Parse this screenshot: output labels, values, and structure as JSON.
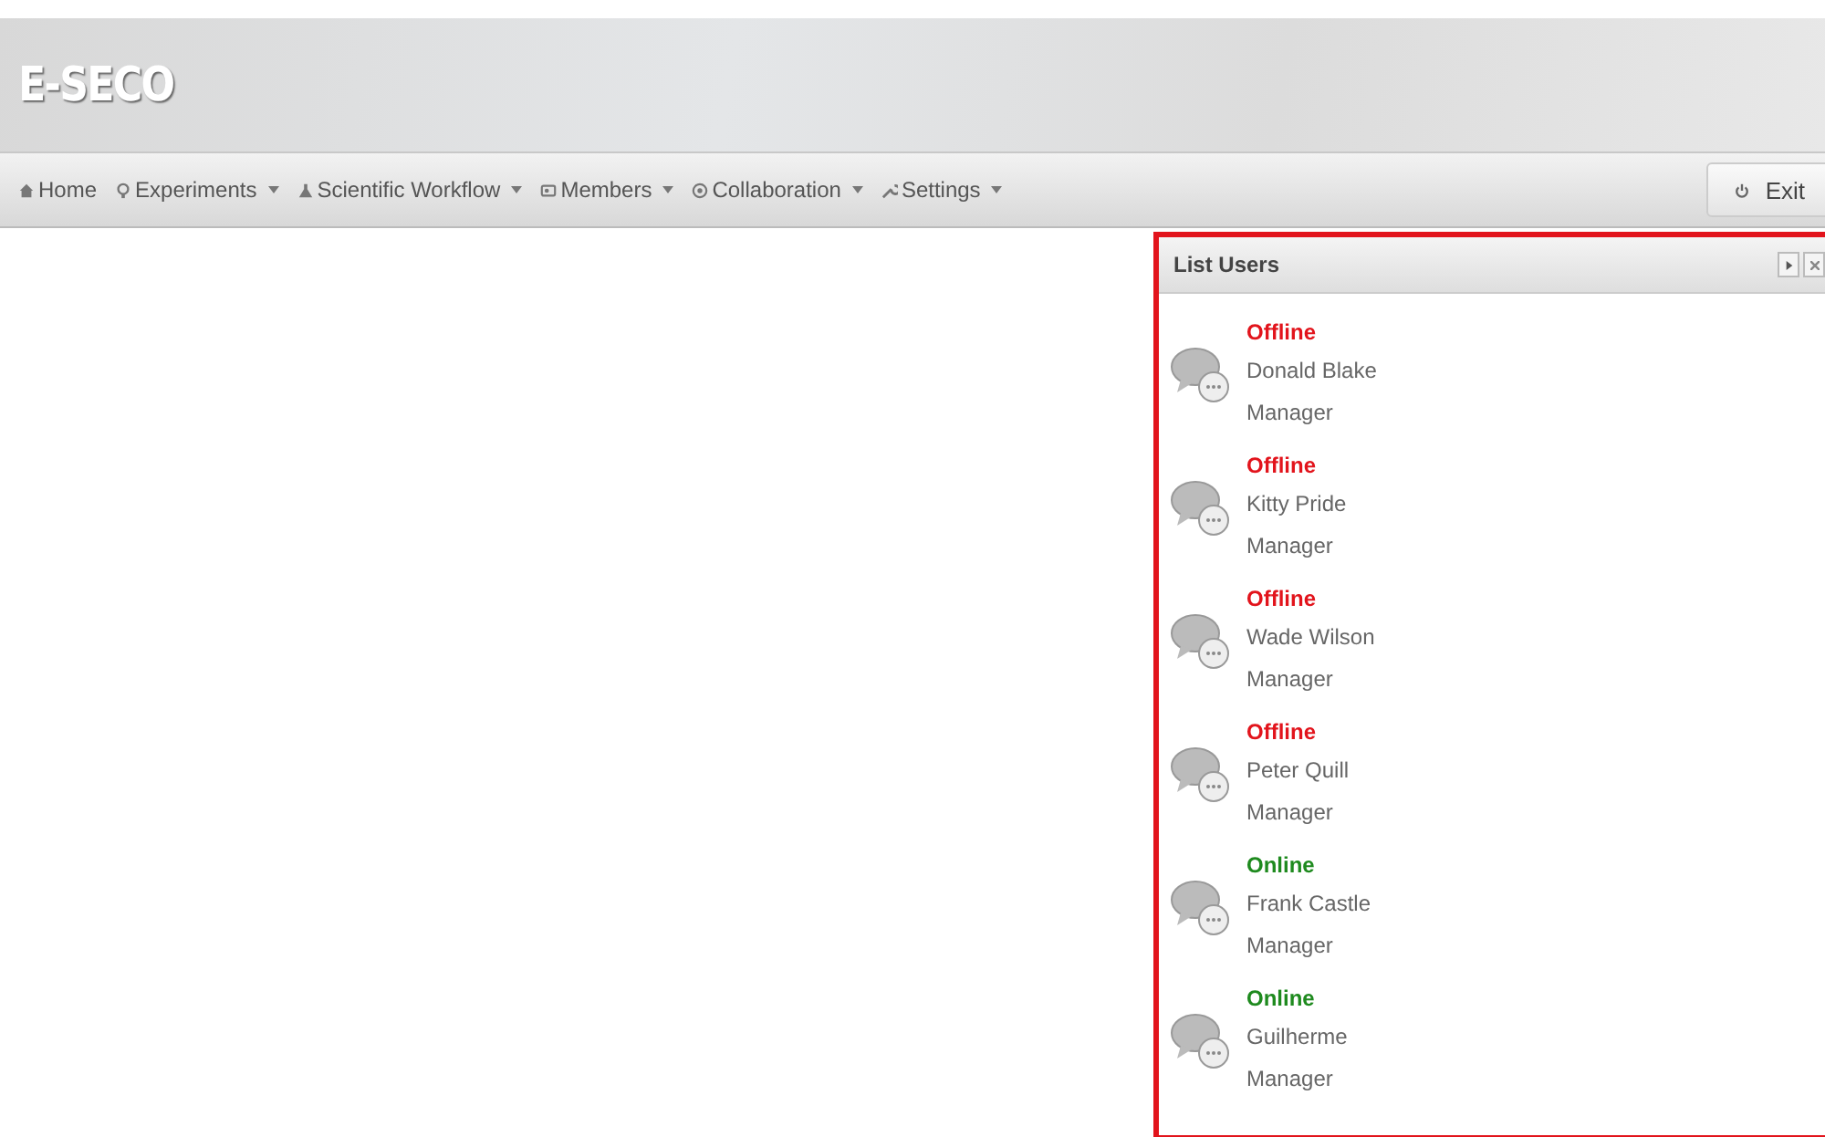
{
  "header": {
    "logo": "E-SECO"
  },
  "nav": {
    "items": [
      {
        "label": "Home",
        "kind": "home",
        "dropdown": false
      },
      {
        "label": "Experiments",
        "kind": "bulb",
        "dropdown": true
      },
      {
        "label": "Scientific Workflow",
        "kind": "flask",
        "dropdown": true
      },
      {
        "label": "Members",
        "kind": "members",
        "dropdown": true
      },
      {
        "label": "Collaboration",
        "kind": "collab",
        "dropdown": true
      },
      {
        "label": "Settings",
        "kind": "wrench",
        "dropdown": true
      }
    ],
    "exit_button": "Exit"
  },
  "panel": {
    "title": "List Users",
    "users": [
      {
        "status": "Offline",
        "online": false,
        "name": "Donald Blake",
        "role": "Manager"
      },
      {
        "status": "Offline",
        "online": false,
        "name": "Kitty Pride",
        "role": "Manager"
      },
      {
        "status": "Offline",
        "online": false,
        "name": "Wade Wilson",
        "role": "Manager"
      },
      {
        "status": "Offline",
        "online": false,
        "name": "Peter Quill",
        "role": "Manager"
      },
      {
        "status": "Online",
        "online": true,
        "name": "Frank Castle",
        "role": "Manager"
      },
      {
        "status": "Online",
        "online": true,
        "name": "Guilherme",
        "role": "Manager"
      }
    ]
  }
}
